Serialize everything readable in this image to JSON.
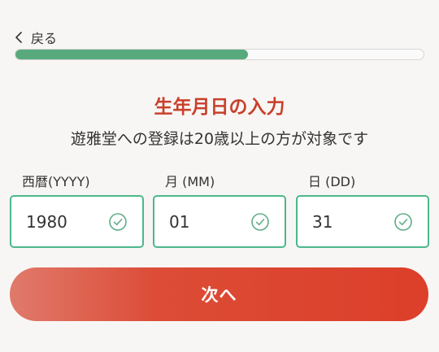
{
  "header": {
    "back_label": "戻る"
  },
  "progress": {
    "fraction": 0.57
  },
  "main": {
    "title": "生年月日の入力",
    "subtitle": "遊雅堂への登録は20歳以上の方が対象です"
  },
  "fields": [
    {
      "label": "西暦(YYYY)",
      "value": "1980",
      "status_icon": "check-circle-icon"
    },
    {
      "label": "月 (MM)",
      "value": "01",
      "status_icon": "check-circle-icon"
    },
    {
      "label": "日 (DD)",
      "value": "31",
      "status_icon": "check-circle-icon"
    }
  ],
  "actions": {
    "next_label": "次へ"
  },
  "colors": {
    "accent_red": "#c8402c",
    "button_red": "#dc3f2a",
    "progress_green": "#58aa7d",
    "field_border_green": "#4bb88c",
    "check_green": "#5fae87",
    "background": "#f8f6f4"
  }
}
